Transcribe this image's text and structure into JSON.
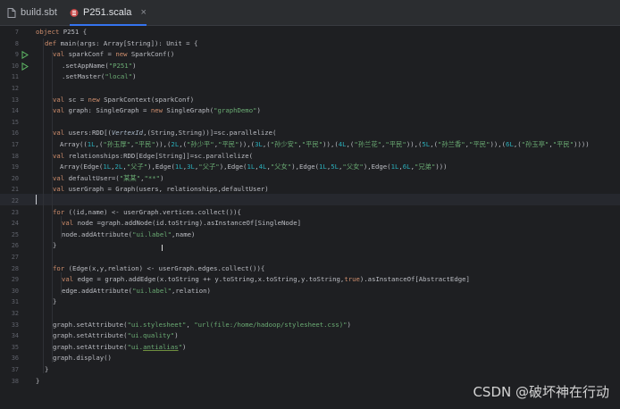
{
  "tabs": [
    {
      "label": "build.sbt",
      "close": ""
    },
    {
      "label": "P251.scala",
      "close": "×"
    }
  ],
  "inspection": {
    "count": "1",
    "up": "∧",
    "down": "∨"
  },
  "watermark": "CSDN @破坏神在行动",
  "line_numbers": [
    "7",
    "8",
    "9",
    "10",
    "11",
    "12",
    "13",
    "14",
    "15",
    "16",
    "17",
    "18",
    "19",
    "20",
    "21",
    "22",
    "23",
    "24",
    "25",
    "26",
    "27",
    "28",
    "29",
    "30",
    "31",
    "32",
    "33",
    "34",
    "35",
    "36"
  ],
  "code": {
    "l7": [
      "object",
      " P251 {"
    ],
    "l8": [
      "def",
      " main(args: Array[String]): Unit = {"
    ],
    "l9": [
      "val",
      " sparkConf = ",
      "new",
      " SparkConf()"
    ],
    "l10": [
      ".setAppName(",
      "\"P251\"",
      ")"
    ],
    "l11": [
      ".setMaster(",
      "\"local\"",
      ")"
    ],
    "l13": [
      "val",
      " sc = ",
      "new",
      " SparkContext(sparkConf)"
    ],
    "l14": [
      "val",
      " graph: SingleGraph = ",
      "new",
      " SingleGraph(",
      "\"graphDemo\"",
      ")"
    ],
    "l16": [
      "val",
      " users:RDD[(",
      "VertexId",
      ",(String,String))]=sc.parallelize("
    ],
    "l17": [
      "Array((",
      "1L",
      ",(",
      "\"孙玉厚\"",
      ",",
      "\"平民\"",
      ")),(",
      "2L",
      ",(",
      "\"孙少平\"",
      ",",
      "\"平民\"",
      ")),(",
      "3L",
      ",(",
      "\"孙少安\"",
      ",",
      "\"平民\"",
      ")),(",
      "4L",
      ",(",
      "\"孙兰花\"",
      ",",
      "\"平民\"",
      ")),(",
      "5L",
      ",(",
      "\"孙兰香\"",
      ",",
      "\"平民\"",
      ")),(",
      "6L",
      ",(",
      "\"孙玉亭\"",
      ",",
      "\"平民\"",
      "))))"
    ],
    "l18": [
      "val",
      " relationships:RDD[Edge[String]]=sc.parallelize("
    ],
    "l19": [
      "Array(Edge(",
      "1L",
      ",",
      "2L",
      ",",
      "\"父子\"",
      "),Edge(",
      "1L",
      ",",
      "3L",
      ",",
      "\"父子\"",
      "),Edge(",
      "1L",
      ",",
      "4L",
      ",",
      "\"父女\"",
      "),Edge(",
      "1L",
      ",",
      "5L",
      ",",
      "\"父女\"",
      "),Edge(",
      "1L",
      ",",
      "6L",
      ",",
      "\"兄弟\"",
      ")))"
    ],
    "l20": [
      "val",
      " defaultUser=(",
      "\"某某\"",
      ",",
      "\"**\"",
      ")"
    ],
    "l21": [
      "val",
      " userGraph = Graph(users, relationships,defaultUser)"
    ],
    "l23": [
      "for",
      " ((id,name) <- userGraph.vertices.collect()){"
    ],
    "l24": [
      "val",
      " node =graph.addNode(id.toString).asInstanceOf[SingleNode]"
    ],
    "l25": [
      "node.addAttribute(",
      "\"ui.label\"",
      ",name)"
    ],
    "l26": [
      "}"
    ],
    "l28": [
      "for",
      " (Edge(x,y,relation) <- userGraph.edges.collect()){"
    ],
    "l29": [
      "val",
      " edge = graph.addEdge(x.toString ++ y.toString,x.toString,y.toString,",
      "true",
      ").asInstanceOf[AbstractEdge]"
    ],
    "l30": [
      "edge.addAttribute(",
      "\"ui.label\"",
      ",relation)"
    ],
    "l31": [
      "}"
    ],
    "l33": [
      "graph.setAttribute(",
      "\"ui.stylesheet\"",
      ", ",
      "\"url(file:/home/hadoop/stylesheet.css)\"",
      ")"
    ],
    "l34": [
      "graph.setAttribute(",
      "\"ui.quality\"",
      ")"
    ],
    "l35": [
      "graph.setAttribute(",
      "\"ui.",
      "antialias",
      "\"",
      ")"
    ],
    "l36": [
      "graph.display()"
    ],
    "l37": [
      "}"
    ],
    "l38": [
      "}"
    ]
  },
  "line_numbers_extra": [
    "37",
    "38"
  ],
  "colors": {
    "background": "#1e1f22",
    "keyword": "#cf8e6d",
    "string": "#6aab73",
    "number": "#2aacb8",
    "accent": "#3574f0"
  }
}
